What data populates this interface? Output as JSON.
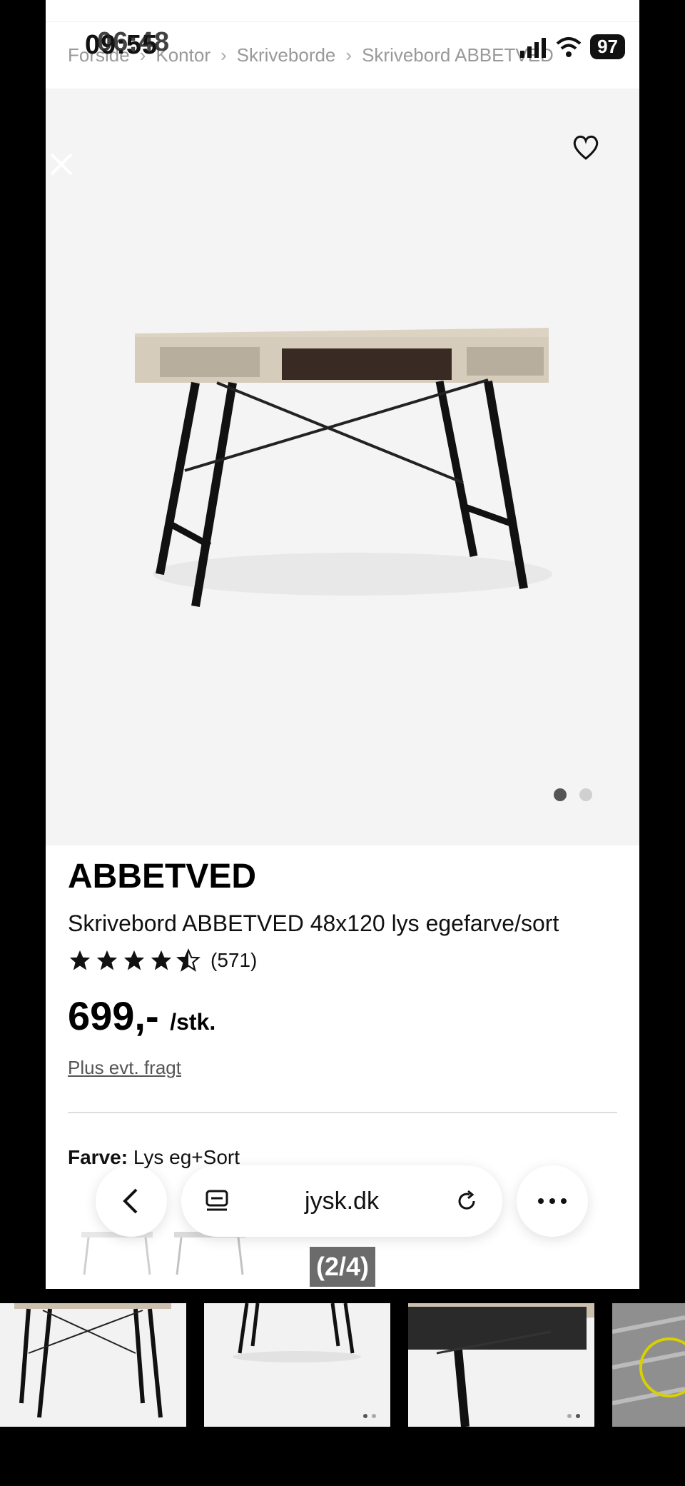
{
  "status": {
    "time": "09:55",
    "time_overlay": "06:48",
    "battery": "97"
  },
  "breadcrumb": [
    "Forside",
    "Kontor",
    "Skriveborde",
    "Skrivebord ABBETVED"
  ],
  "product": {
    "brand": "ABBETVED",
    "name": "Skrivebord ABBETVED 48x120 lys egefarve/sort",
    "rating": 4.5,
    "rating_count": "(571)",
    "price": "699,-",
    "price_unit": "/stk.",
    "shipping": "Plus evt. fragt",
    "color_label": "Farve:",
    "color_value": "Lys eg+Sort"
  },
  "browser": {
    "url": "jysk.dk"
  },
  "gallery": {
    "counter": "(2/4)",
    "hero_active_dot": 0,
    "hero_dot_count": 2
  },
  "icons": [
    "close-icon",
    "heart-icon",
    "back-icon",
    "tabs-icon",
    "reload-icon",
    "more-icon",
    "signal-icon",
    "wifi-icon"
  ]
}
